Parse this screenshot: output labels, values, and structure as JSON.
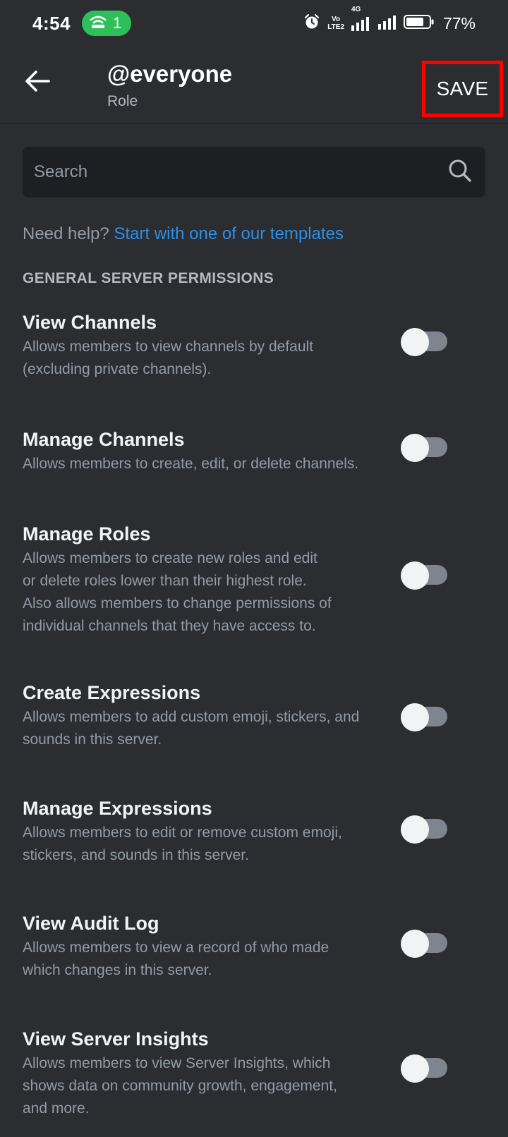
{
  "status_bar": {
    "time": "4:54",
    "hotspot_count": "1",
    "network_line1": "Vo",
    "network_line2": "LTE2",
    "network_type": "4G",
    "battery": "77%"
  },
  "header": {
    "title": "@everyone",
    "subtitle": "Role",
    "save_label": "SAVE"
  },
  "search": {
    "placeholder": "Search"
  },
  "help": {
    "text": "Need help? ",
    "link": "Start with one of our templates"
  },
  "section": {
    "title": "GENERAL SERVER PERMISSIONS"
  },
  "permissions": [
    {
      "title": "View Channels",
      "lines": [
        "Allows members to view channels by default",
        "(excluding private channels)."
      ],
      "enabled": false
    },
    {
      "title": "Manage Channels",
      "lines": [
        "Allows members to create, edit, or delete channels."
      ],
      "enabled": false
    },
    {
      "title": "Manage Roles",
      "lines": [
        "Allows members to create new roles and edit",
        "or delete roles lower than their highest role.",
        "Also allows members to change permissions of",
        "individual channels that they have access to."
      ],
      "enabled": false
    },
    {
      "title": "Create Expressions",
      "lines": [
        "Allows members to add custom emoji, stickers, and",
        "sounds in this server."
      ],
      "enabled": false
    },
    {
      "title": "Manage Expressions",
      "lines": [
        "Allows members to edit or remove custom emoji,",
        "stickers, and sounds in this server."
      ],
      "enabled": false
    },
    {
      "title": "View Audit Log",
      "lines": [
        "Allows members to view a record of who made",
        "which changes in this server."
      ],
      "enabled": false
    },
    {
      "title": "View Server Insights",
      "lines": [
        "Allows members to view Server Insights, which",
        "shows data on community growth, engagement,",
        "and more."
      ],
      "enabled": false
    }
  ]
}
